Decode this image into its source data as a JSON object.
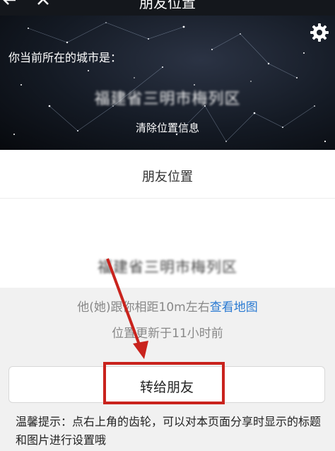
{
  "topbar": {
    "title": "朋友位置",
    "back_icon": "back-arrow-icon",
    "close_icon": "close-icon"
  },
  "header": {
    "settings_icon": "gear-icon",
    "city_label": "你当前所在的城市是：",
    "city_value": "福建省三明市梅列区",
    "clear_link": "清除位置信息"
  },
  "card": {
    "title": "朋友位置",
    "friend_location": "福建省三明市梅列区"
  },
  "info": {
    "distance_prefix": "他(她)跟你相距10m左右",
    "map_link": "查看地图",
    "update_text": "位置更新于11小时前"
  },
  "actions": {
    "forward_label": "转给朋友"
  },
  "tip": {
    "text": "温馨提示：点右上角的齿轮，可以对本页面分享时显示的标题和图片进行设置哦"
  },
  "colors": {
    "accent_link": "#2a7ad2",
    "annotation_red": "#c9231d"
  }
}
